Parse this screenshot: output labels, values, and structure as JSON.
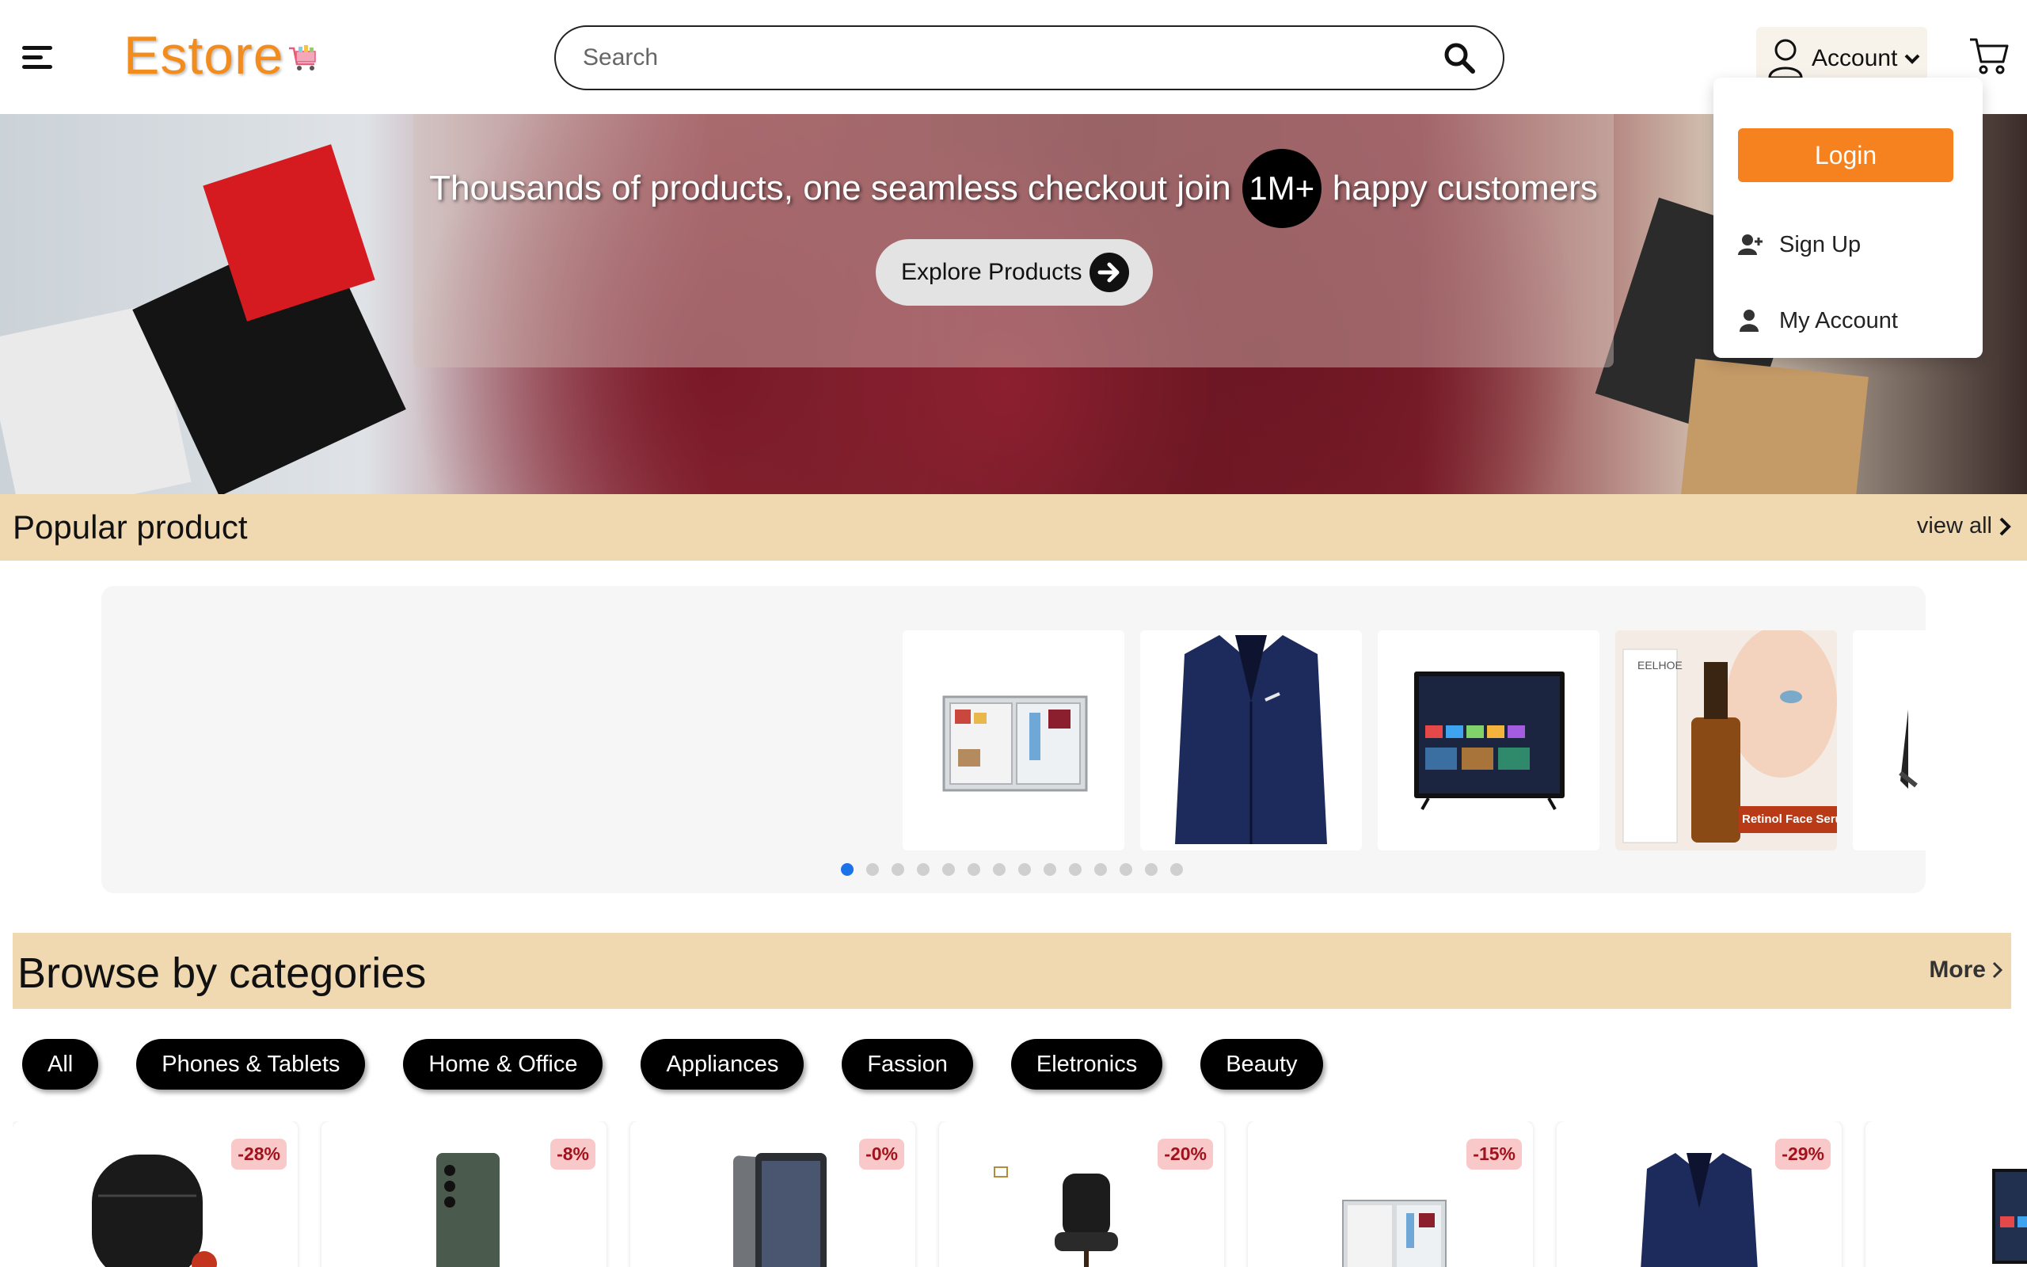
{
  "header": {
    "logo_text": "Estore",
    "search_placeholder": "Search",
    "account_label": "Account",
    "dropdown": {
      "login_label": "Login",
      "signup_label": "Sign Up",
      "my_account_label": "My Account"
    }
  },
  "hero": {
    "text_before": "Thousands of products, one seamless checkout join",
    "badge": "1M+",
    "text_after": "happy customers",
    "cta_label": "Explore Products"
  },
  "popular": {
    "title": "Popular product",
    "view_all_label": "view all",
    "items": [
      "mini-fridge",
      "navy-blazer",
      "smart-tv",
      "retinol-serum",
      "monitor"
    ],
    "dot_count": 14,
    "active_dot": 0,
    "serum_brand": "EELHOE",
    "serum_label": "Retinol Face Serum"
  },
  "categories": {
    "title": "Browse by categories",
    "more_label": "More",
    "pills": [
      "All",
      "Phones & Tablets",
      "Home & Office",
      "Appliances",
      "Fassion",
      "Eletronics",
      "Beauty"
    ]
  },
  "products": [
    {
      "discount": "-28%",
      "icon": "earbuds-case"
    },
    {
      "discount": "-8%",
      "icon": "smartphone"
    },
    {
      "discount": "-0%",
      "icon": "tablet"
    },
    {
      "discount": "-20%",
      "icon": "office-chair"
    },
    {
      "discount": "-15%",
      "icon": "mini-fridge"
    },
    {
      "discount": "-29%",
      "icon": "navy-blazer"
    },
    {
      "discount": "",
      "icon": "smart-tv"
    }
  ],
  "colors": {
    "brand": "#f28c1c",
    "login_button": "#f5821f",
    "section_bar": "#f0d9b0",
    "active_dot": "#1a73e8"
  }
}
